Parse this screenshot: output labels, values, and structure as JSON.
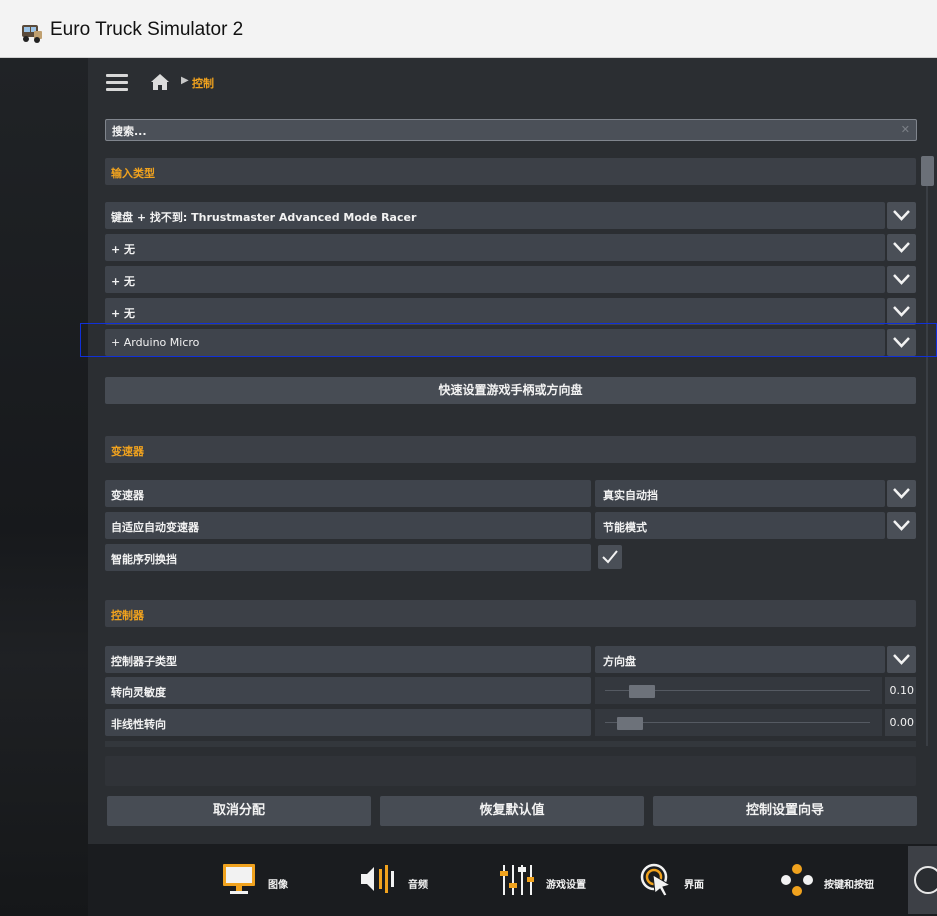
{
  "window": {
    "title": "Euro Truck Simulator 2"
  },
  "breadcrumb": {
    "current": "控制"
  },
  "search": {
    "placeholder": "搜索..."
  },
  "sections": {
    "input_type": "输入类型",
    "transmission": "变速器",
    "controller": "控制器"
  },
  "inputs": [
    {
      "label": "键盘 + 找不到: Thrustmaster Advanced Mode Racer"
    },
    {
      "label": "+ 无"
    },
    {
      "label": "+ 无"
    },
    {
      "label": "+ 无"
    },
    {
      "label": "+ Arduino Micro"
    }
  ],
  "quick_setup": {
    "label": "快速设置游戏手柄或方向盘"
  },
  "transmission_settings": [
    {
      "label": "变速器",
      "value": "真实自动挡"
    },
    {
      "label": "自适应自动变速器",
      "value": "节能模式"
    },
    {
      "label": "智能序列换挡",
      "checked": true
    }
  ],
  "controller_settings": {
    "subtype": {
      "label": "控制器子类型",
      "value": "方向盘"
    },
    "steering_sensitivity": {
      "label": "转向灵敏度",
      "value": "0.10",
      "level": 0.1
    },
    "nonlinear_steering": {
      "label": "非线性转向",
      "value": "0.00",
      "level": 0.05
    }
  },
  "footer_buttons": {
    "unassign": "取消分配",
    "restore_defaults": "恢复默认值",
    "wizard": "控制设置向导"
  },
  "bottom_nav": [
    {
      "label": "图像",
      "icon": "monitor-icon"
    },
    {
      "label": "音频",
      "icon": "speaker-icon"
    },
    {
      "label": "游戏设置",
      "icon": "sliders-icon"
    },
    {
      "label": "界面",
      "icon": "cursor-icon"
    },
    {
      "label": "按键和按钮",
      "icon": "gamepad-buttons-icon"
    }
  ],
  "colors": {
    "accent": "#f0a21e",
    "highlight_border": "#1030d8"
  }
}
